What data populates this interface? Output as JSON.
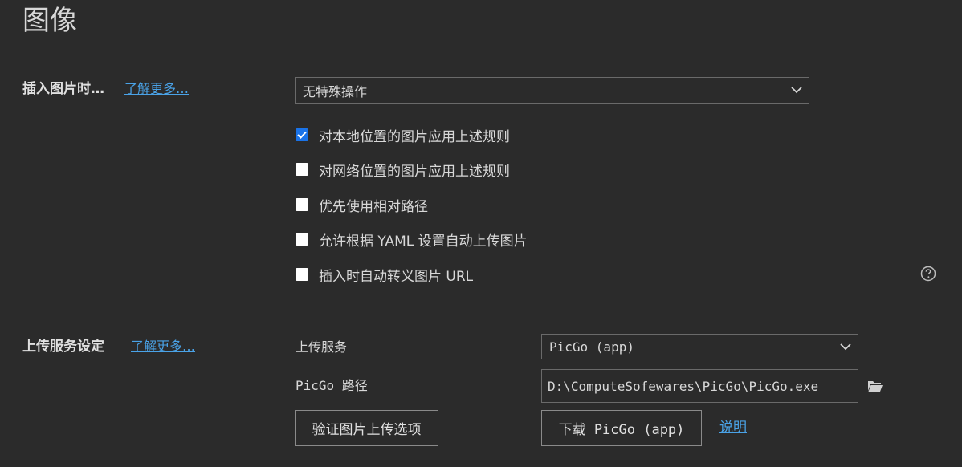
{
  "page": {
    "title": "图像"
  },
  "insert_section": {
    "label": "插入图片时…",
    "learn_more": "了解更多…",
    "action_select": {
      "value": "无特殊操作",
      "icon": "chevron-down-icon"
    },
    "options": [
      {
        "label": "对本地位置的图片应用上述规则",
        "checked": true
      },
      {
        "label": "对网络位置的图片应用上述规则",
        "checked": false
      },
      {
        "label": "优先使用相对路径",
        "checked": false
      },
      {
        "label": "允许根据 YAML 设置自动上传图片",
        "checked": false
      },
      {
        "label": "插入时自动转义图片 URL",
        "checked": false
      }
    ],
    "help_icon": "question-circle-icon"
  },
  "upload_section": {
    "label": "上传服务设定",
    "learn_more": "了解更多…",
    "service_label": "上传服务",
    "service_select": {
      "value": "PicGo (app)",
      "icon": "chevron-down-icon"
    },
    "path_label": "PicGo 路径",
    "path_value": "D:\\ComputeSofewares\\PicGo\\PicGo.exe",
    "folder_icon": "folder-icon",
    "verify_button": "验证图片上传选项",
    "download_button": "下载 PicGo (app)",
    "explain_link": "说明"
  },
  "colors": {
    "background": "#2b2b2b",
    "link": "#4aa3e8",
    "checkbox_checked": "#1a73e8",
    "border": "#6a6a6a"
  }
}
